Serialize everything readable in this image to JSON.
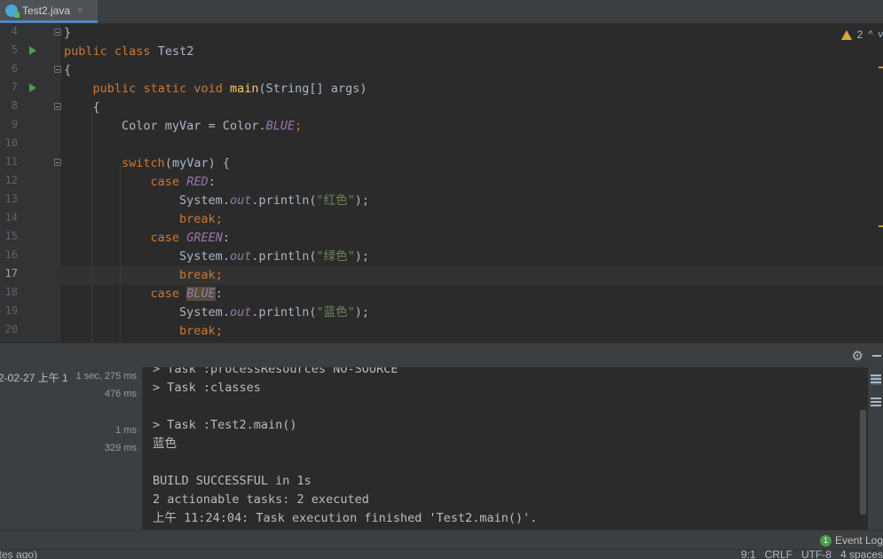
{
  "tab": {
    "title": "Test2.java",
    "close": "×"
  },
  "editor": {
    "line_numbers": [
      "4",
      "5",
      "6",
      "7",
      "8",
      "9",
      "10",
      "11",
      "12",
      "13",
      "14",
      "15",
      "16",
      "17",
      "18",
      "19",
      "20"
    ],
    "current_line": "17",
    "code": {
      "l4": "}",
      "l5_kw1": "public",
      "l5_kw2": "class",
      "l5_name": "Test2",
      "l6": "{",
      "l7_kw1": "public",
      "l7_kw2": "static",
      "l7_kw3": "void",
      "l7_fn": "main",
      "l7_rest": "(String[] args)",
      "l8": "{",
      "l9_a": "Color myVar = Color.",
      "l9_const": "BLUE",
      "l9_b": ";",
      "l11_kw": "switch",
      "l11_rest": "(myVar) {",
      "l12_kw": "case",
      "l12_const": "RED",
      "l12_b": ":",
      "l13_a": "System.",
      "l13_out": "out",
      "l13_b": ".println(",
      "l13_str": "\"红色\"",
      "l13_c": ");",
      "l14_kw": "break",
      "l14_b": ";",
      "l15_kw": "case",
      "l15_const": "GREEN",
      "l15_b": ":",
      "l16_a": "System.",
      "l16_out": "out",
      "l16_b": ".println(",
      "l16_str": "\"绿色\"",
      "l16_c": ");",
      "l17_kw": "break",
      "l17_b": ";",
      "l18_kw": "case",
      "l18_const": "BLUE",
      "l18_b": ":",
      "l19_a": "System.",
      "l19_out": "out",
      "l19_b": ".println(",
      "l19_str": "\"蓝色\"",
      "l19_c": ");",
      "l20_kw": "break",
      "l20_b": ";"
    },
    "inspection": {
      "warning_count": "2",
      "up": "^",
      "down": "v"
    }
  },
  "run_tree": [
    {
      "label": "2-02-27 上午 1",
      "duration": "1 sec, 275 ms"
    },
    {
      "label": "",
      "duration": "476 ms"
    },
    {
      "label": "",
      "duration": "1 ms"
    },
    {
      "label": "",
      "duration": "329 ms"
    }
  ],
  "console_lines": [
    "> Task :processResources NO-SOURCE",
    "> Task :classes",
    "",
    "> Task :Test2.main()",
    "蓝色",
    "",
    "BUILD SUCCESSFUL in 1s",
    "2 actionable tasks: 2 executed",
    "上午 11:24:04: Task execution finished 'Test2.main()'."
  ],
  "event_log": {
    "count": "1",
    "label": "Event Log"
  },
  "status": {
    "left": "utes ago)",
    "position": "9:1",
    "line_sep": "CRLF",
    "encoding": "UTF-8",
    "indent": "4 spaces"
  },
  "colors": {
    "keyword": "#cc7832",
    "function": "#ffc66d",
    "string": "#6a8759",
    "constant": "#9876aa",
    "background": "#2b2b2b",
    "panel": "#3c3f41",
    "run_icon": "#499c54"
  }
}
